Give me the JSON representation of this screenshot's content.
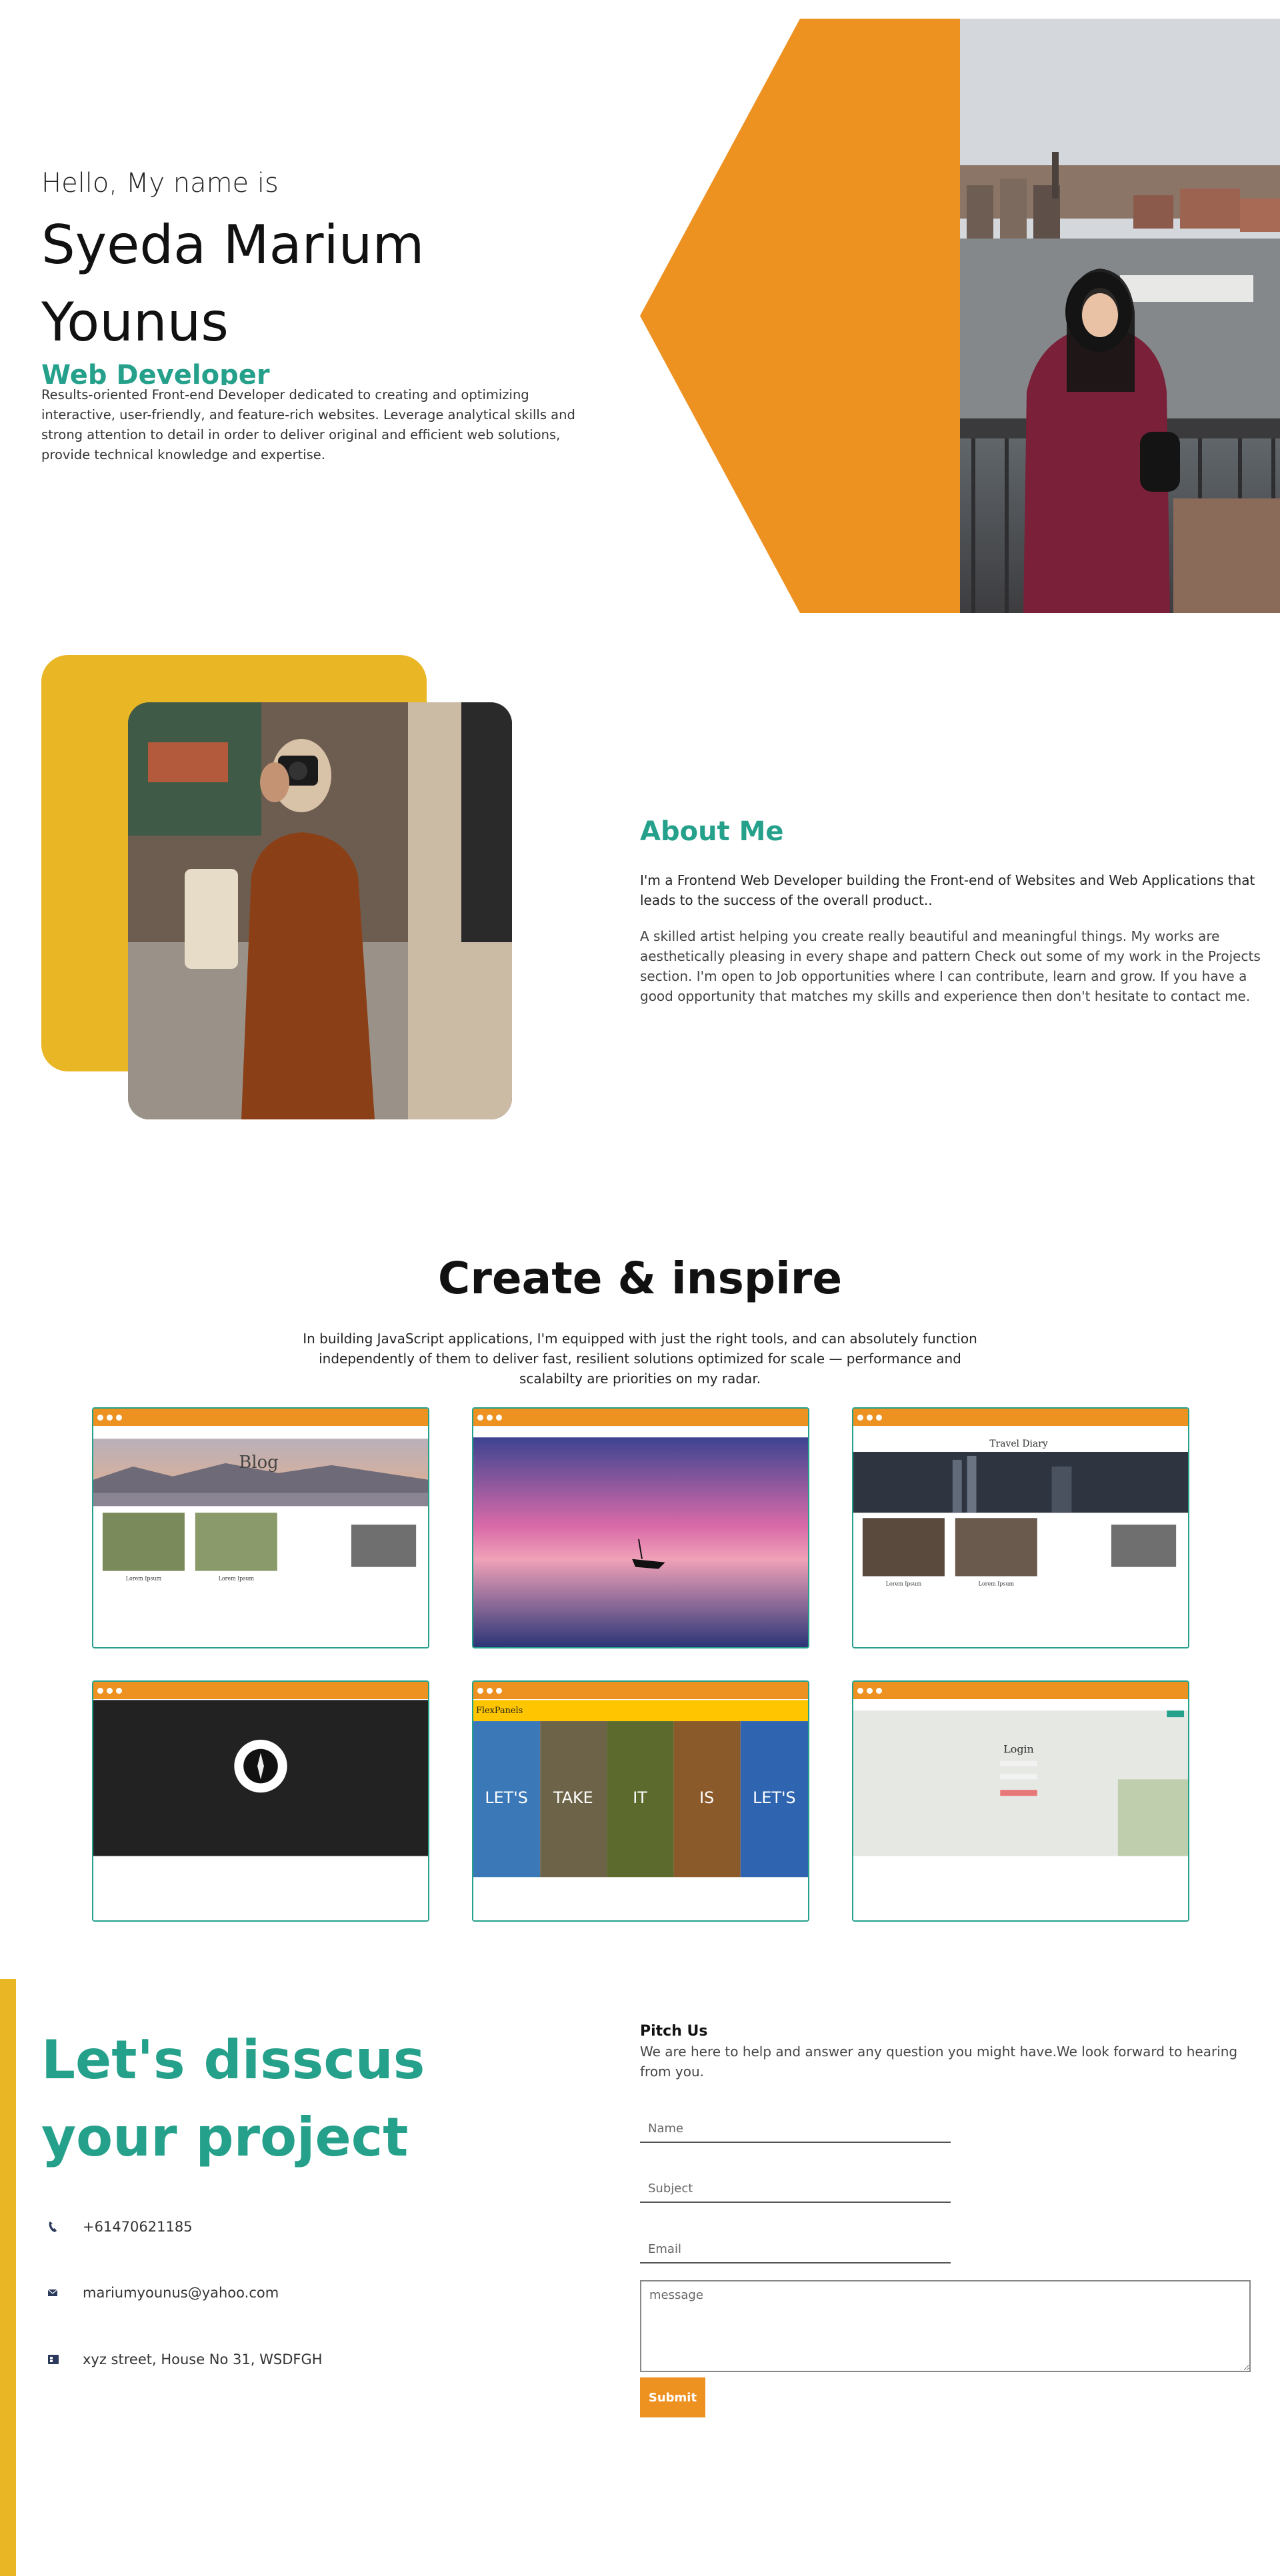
{
  "hero": {
    "greeting": "Hello, My name is",
    "name": "Syeda Marium Younus",
    "role": "Web Developer",
    "description": "Results-oriented Front-end Developer dedicated to creating and optimizing interactive, user-friendly, and feature-rich websites. Leverage analytical skills and strong attention to detail in order to deliver original and efficient web solutions, provide technical knowledge and expertise."
  },
  "about": {
    "title": "About Me",
    "paragraph1": "I'm a Frontend Web Developer building the Front-end of Websites and Web Applications that leads to the success of the overall product..",
    "paragraph2": "A skilled artist helping you create really beautiful and meaningful things. My works are aesthetically pleasing in every shape and pattern Check out some of my work in the Projects section. I'm open to Job opportunities where I can contribute, learn and grow. If you have a good opportunity that matches my skills and experience then don't hesitate to contact me."
  },
  "projects": {
    "title": "Create & inspire",
    "subtitle": "In building JavaScript applications, I'm equipped with just the right tools, and can absolutely function independently of them to deliver fast, resilient solutions optimized for scale — performance and scalabilty are priorities on my radar.",
    "cards": [
      {
        "blog_word": "Blog",
        "item_label": "Lorem Ipsum"
      },
      {},
      {
        "heading": "Travel Diary",
        "item_label": "Lorem Ipsum"
      },
      {},
      {
        "heading": "FlexPanels",
        "panels": [
          "LET'S",
          "TAKE",
          "IT",
          "IS",
          "LET'S"
        ]
      },
      {
        "heading": "Login"
      }
    ]
  },
  "contact": {
    "title": "Let's disscus your project",
    "phone": "+61470621185",
    "email": "mariumyounus@yahoo.com",
    "address": "xyz street, House No 31, WSDFGH",
    "pitch_title": "Pitch Us",
    "pitch_desc": "We are here to help and answer any question you might have.We look forward to hearing from you.",
    "name_placeholder": "Name",
    "subject_placeholder": "Subject",
    "email_placeholder": "Email",
    "message_placeholder": "message",
    "submit_label": "Submit"
  },
  "colors": {
    "accent": "#24a08b",
    "orange": "#ed9121",
    "yellow": "#e9b626"
  },
  "icons": [
    "phone-icon",
    "mail-icon",
    "address-card-icon"
  ]
}
